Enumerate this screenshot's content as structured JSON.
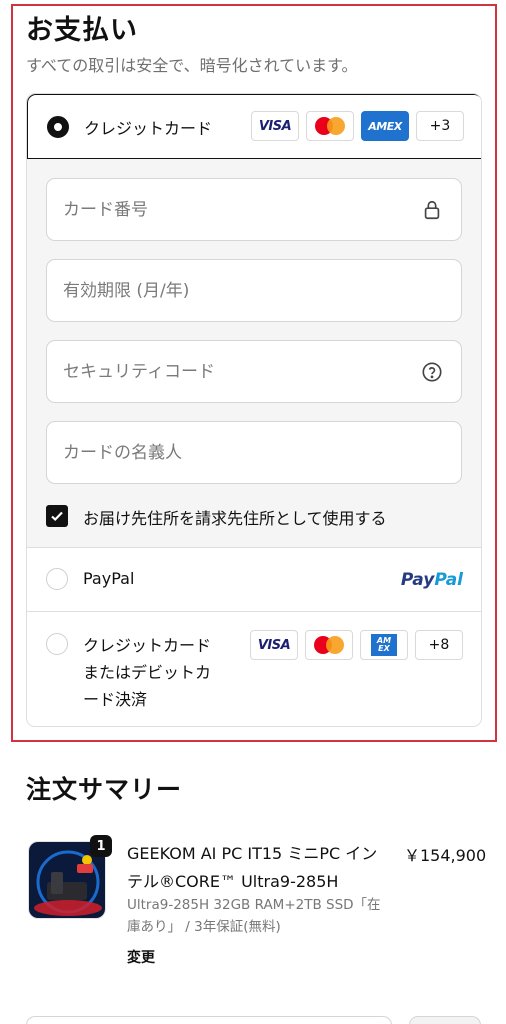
{
  "payment": {
    "title": "お支払い",
    "subtitle": "すべての取引は安全で、暗号化されています。",
    "credit_card": {
      "label": "クレジットカード",
      "brands": [
        "VISA",
        "Mastercard",
        "AMEX"
      ],
      "more_count": "+3",
      "fields": {
        "card_number_placeholder": "カード番号",
        "expiry_placeholder": "有効期限 (月/年)",
        "security_code_placeholder": "セキュリティコード",
        "name_placeholder": "カードの名義人"
      },
      "same_address_label": "お届け先住所を請求先住所として使用する",
      "same_address_checked": true
    },
    "paypal": {
      "label": "PayPal",
      "logo_part1": "Pay",
      "logo_part2": "Pal"
    },
    "debit_option": {
      "label_line1": "クレジットカード",
      "label_line2": "またはデビットカ",
      "label_line3": "ード決済",
      "more_count": "+8"
    }
  },
  "summary": {
    "title": "注文サマリー",
    "item": {
      "quantity": "1",
      "name": "GEEKOM AI PC IT15 ミニPC インテル®CORE™ Ultra9-285H",
      "price": "￥154,900",
      "variant": "Ultra9-285H 32GB RAM+2TB SSD「在庫あり」 / 3年保証(無料)",
      "change_label": "変更"
    }
  },
  "colors": {
    "highlight_border": "#d0343f",
    "visa": "#1a1f71",
    "amex": "#1f72cd",
    "paypal_dark": "#253b80",
    "paypal_light": "#179bd7"
  }
}
